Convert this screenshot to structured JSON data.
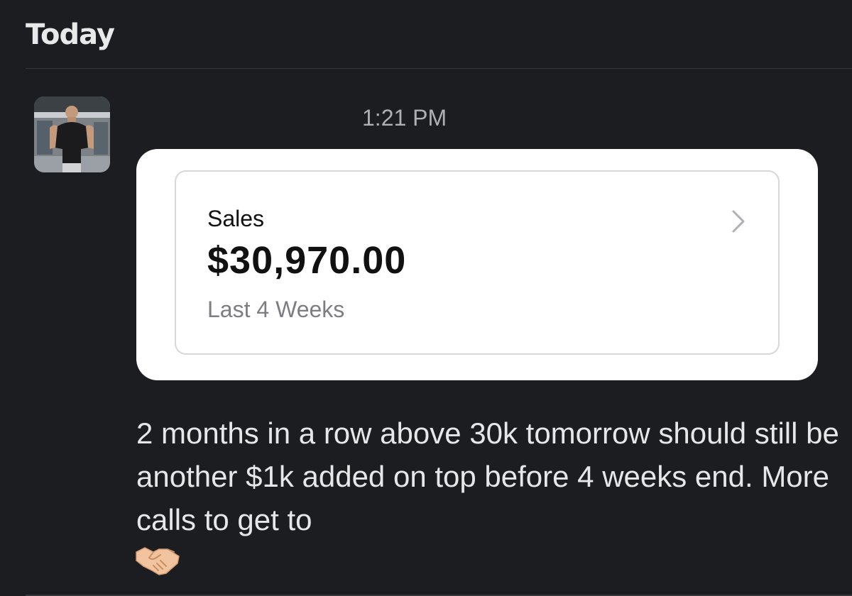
{
  "header": {
    "day_label": "Today"
  },
  "message": {
    "avatar_icon": "user-avatar-photo",
    "timestamp": "1:21 PM",
    "attachment": {
      "widget_title": "Sales",
      "widget_amount": "$30,970.00",
      "widget_period": "Last 4 Weeks",
      "chevron_icon": "chevron-right-icon"
    },
    "text": "2 months in a row above 30k tomorrow should still be another $1k added on top before 4 weeks end. More calls to get to",
    "emoji_icon": "handshake-emoji"
  },
  "colors": {
    "background": "#1b1d21",
    "text": "#e6e7e8",
    "card": "#ffffff",
    "muted": "#7e7e82"
  }
}
